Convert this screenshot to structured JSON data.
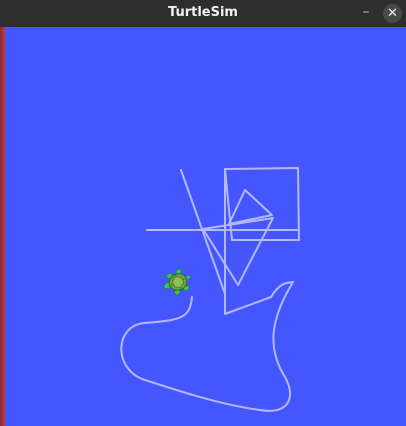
{
  "window": {
    "title": "TurtleSim",
    "minimize_symbol": "–",
    "close_symbol": "✕"
  },
  "canvas": {
    "background": "#4556ff",
    "pen_color": "#b3b8ff",
    "turtle_icon": "turtle-icon"
  }
}
